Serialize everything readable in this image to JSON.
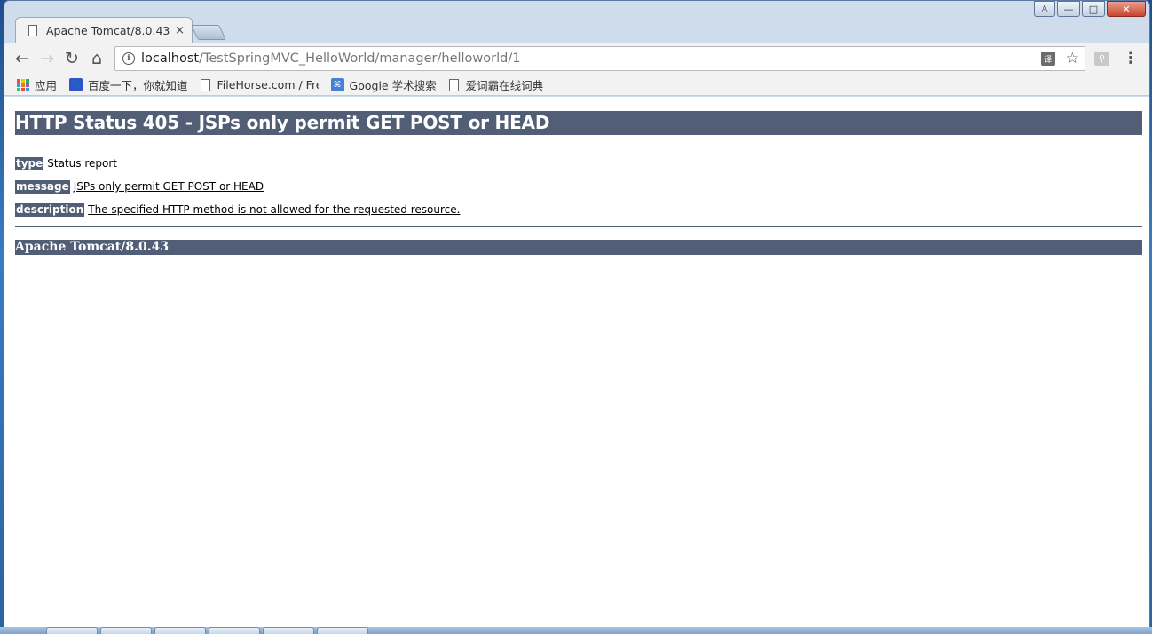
{
  "window": {
    "controls": {
      "user": "♙",
      "minimize": "—",
      "maximize": "□",
      "close": "✕"
    }
  },
  "tab": {
    "title": "Apache Tomcat/8.0.43",
    "close": "×"
  },
  "toolbar": {
    "back": "←",
    "forward": "→",
    "reload": "↻",
    "home": "⌂",
    "url_host": "localhost",
    "url_path": "/TestSpringMVC_HelloWorld/manager/helloworld/1",
    "info_glyph": "i",
    "star_glyph": "☆",
    "menu_glyph": "⋮"
  },
  "bookmarks": [
    {
      "label": "应用"
    },
    {
      "label": "百度一下，你就知道"
    },
    {
      "label": "FileHorse.com / Free"
    },
    {
      "label": "Google 学术搜索"
    },
    {
      "label": "爱词霸在线词典"
    }
  ],
  "error_page": {
    "heading": "HTTP Status 405 - JSPs only permit GET POST or HEAD",
    "type_label": "type",
    "type_value": "Status report",
    "message_label": "message",
    "message_value": "JSPs only permit GET POST or HEAD",
    "description_label": "description",
    "description_value": "The specified HTTP method is not allowed for the requested resource.",
    "footer": "Apache Tomcat/8.0.43"
  },
  "colors": {
    "tomcat_header_bg": "#525d76",
    "page_bg": "#ffffff",
    "chrome_toolbar_bg": "#f2f2f2"
  }
}
